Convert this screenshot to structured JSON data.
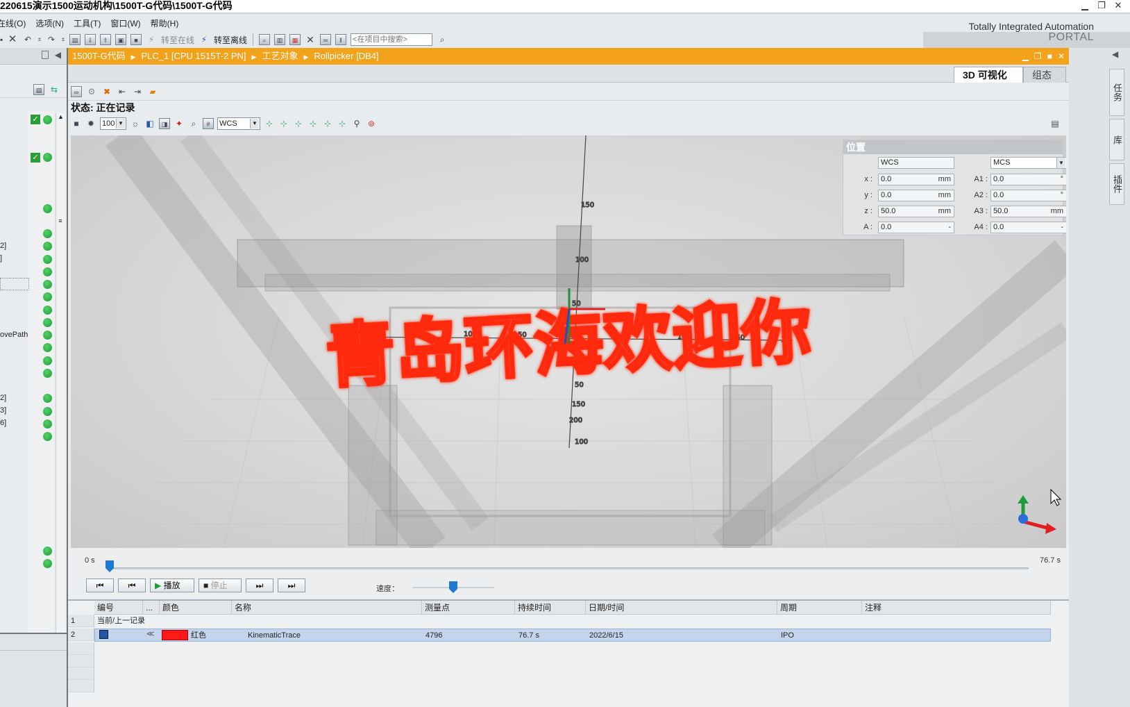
{
  "window": {
    "title": "220615演示1500运动机构\\1500T-G代码\\1500T-G代码"
  },
  "menu": [
    "在线(O)",
    "选项(N)",
    "工具(T)",
    "窗口(W)",
    "帮助(H)"
  ],
  "brand": {
    "line1": "Totally Integrated Automation",
    "line2": "PORTAL"
  },
  "toolbar": {
    "go_online": "转至在线",
    "go_offline": "转至离线",
    "search_placeholder": "<在项目中搜索>"
  },
  "breadcrumb": [
    "1500T-G代码",
    "PLC_1 [CPU 1515T-2 PN]",
    "工艺对象",
    "Rollpicker [DB4]"
  ],
  "tabs": {
    "visualization": "3D 可视化",
    "config": "组态"
  },
  "status": "状态: 正在记录",
  "view": {
    "zoom": "100",
    "coord_system": "WCS"
  },
  "position_panel": {
    "title": "位置",
    "left_system": "WCS",
    "right_system": "MCS",
    "rows": [
      {
        "label": "x",
        "value": "0.0",
        "unit": "mm",
        "a_label": "A1",
        "a_value": "0.0",
        "a_unit": "°"
      },
      {
        "label": "y",
        "value": "0.0",
        "unit": "mm",
        "a_label": "A2",
        "a_value": "0.0",
        "a_unit": "°"
      },
      {
        "label": "z",
        "value": "50.0",
        "unit": "mm",
        "a_label": "A3",
        "a_value": "50.0",
        "a_unit": "mm"
      },
      {
        "label": "A",
        "value": "0.0",
        "unit": "-",
        "a_label": "A4",
        "a_value": "0.0",
        "a_unit": "-"
      }
    ]
  },
  "scene": {
    "trace_text": "青岛环海欢迎你",
    "trace_color": "#ff2a10",
    "axis_labels": [
      "150",
      "100",
      "50",
      "200",
      "150",
      "100",
      "50",
      "50",
      "100",
      "150",
      "50",
      "150",
      "200",
      "100",
      "X"
    ]
  },
  "timeline": {
    "start": "0 s",
    "end": "76.7 s",
    "position_fraction": 0.0,
    "speed_label": "速度：",
    "speed_fraction": 0.5
  },
  "player": {
    "play": "播放",
    "stop": "停止"
  },
  "left_tree_fragments": [
    "2]",
    "]",
    "ovePath",
    "2]",
    "3]",
    "6]"
  ],
  "table": {
    "headers": [
      "编号",
      "...",
      "颜色",
      "名称",
      "测量点",
      "持续时间",
      "日期/时间",
      "周期",
      "注释"
    ],
    "rows": [
      {
        "num": "1",
        "id": "当前/上一记录",
        "color_name": "",
        "name": "",
        "points": "",
        "duration": "",
        "date": "",
        "cycle": "",
        "comment": ""
      },
      {
        "num": "2",
        "id": "",
        "color_name": "红色",
        "color_hex": "#ff1a1a",
        "name": "KinematicTrace",
        "points": "4796",
        "duration": "76.7 s",
        "date": "2022/6/15",
        "cycle": "IPO",
        "comment": ""
      }
    ]
  },
  "right_tabs": [
    "任务",
    "库",
    "插件"
  ]
}
